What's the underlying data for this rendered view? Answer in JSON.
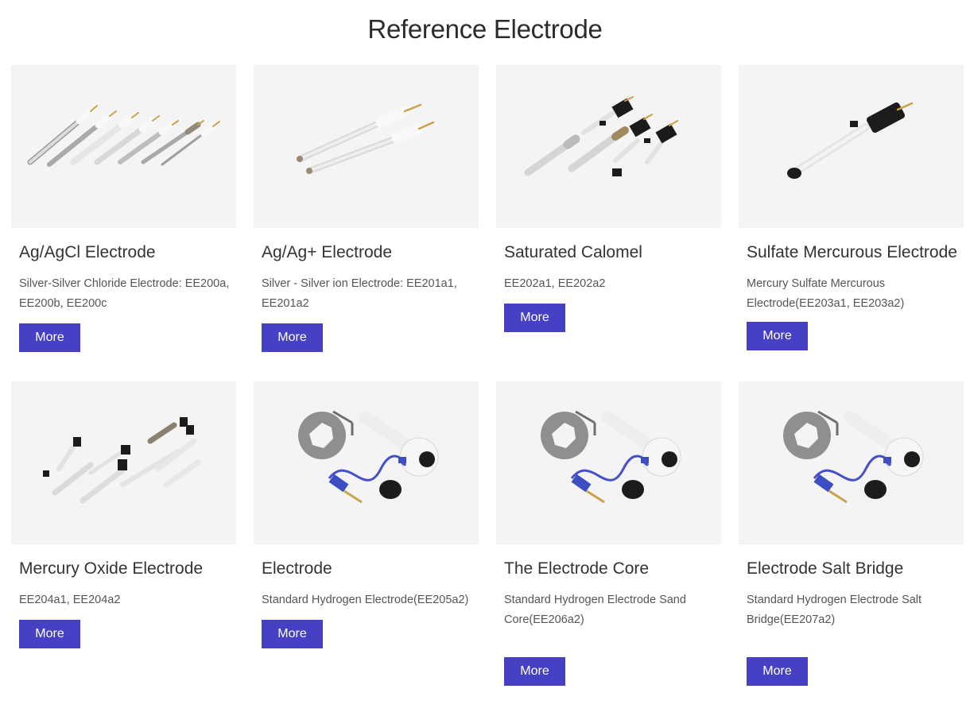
{
  "page": {
    "title": "Reference Electrode"
  },
  "colors": {
    "button": "#4641c4",
    "image_bg": "#f4f4f4"
  },
  "products": [
    {
      "name": "Ag/AgCl Electrode",
      "description": "Silver-Silver Chloride Electrode: EE200a, EE200b, EE200c",
      "button": "More",
      "image": "multi-electrode-image"
    },
    {
      "name": "Ag/Ag+ Electrode",
      "description": "Silver - Silver ion Electrode: EE201a1, EE201a2",
      "button": "More",
      "image": "twin-electrode-image"
    },
    {
      "name": "Saturated Calomel",
      "description": "EE202a1, EE202a2",
      "button": "More",
      "image": "calomel-electrode-image"
    },
    {
      "name": "Sulfate Mercurous Electrode",
      "description": "Mercury Sulfate Mercurous Electrode(EE203a1, EE203a2)",
      "button": "More",
      "image": "sulfate-electrode-image"
    },
    {
      "name": "Mercury Oxide Electrode",
      "description": "EE204a1, EE204a2",
      "button": "More",
      "image": "oxide-electrode-image"
    },
    {
      "name": "Electrode",
      "description": "Standard Hydrogen Electrode(EE205a2)",
      "button": "More",
      "image": "hydrogen-electrode-image"
    },
    {
      "name": "The Electrode Core",
      "description": "Standard Hydrogen Electrode Sand Core(EE206a2)",
      "button": "More",
      "image": "hydrogen-electrode-image"
    },
    {
      "name": "Electrode Salt Bridge",
      "description": "Standard Hydrogen Electrode Salt Bridge(EE207a2)",
      "button": "More",
      "image": "hydrogen-electrode-image"
    }
  ]
}
